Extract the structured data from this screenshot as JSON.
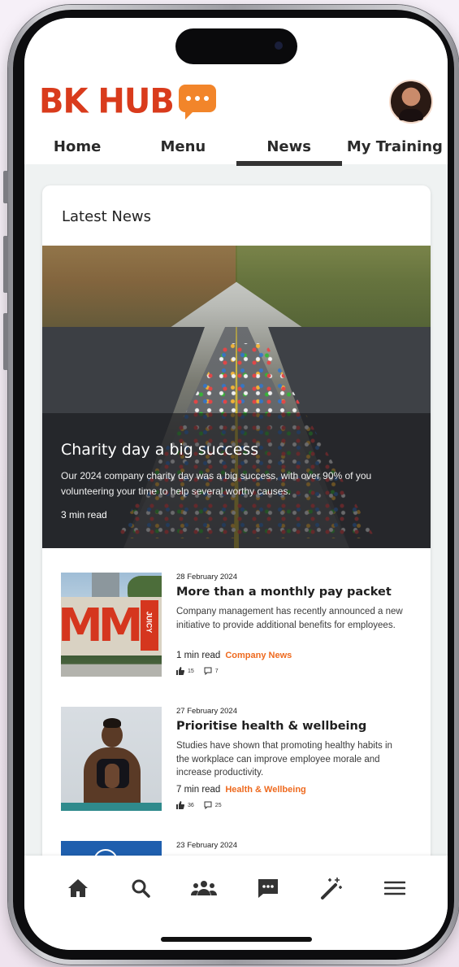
{
  "app": {
    "logo_text": "BK HUB",
    "brand_color": "#d93b1c",
    "accent_color": "#f2852a"
  },
  "tabs": [
    {
      "label": "Home",
      "active": false
    },
    {
      "label": "Menu",
      "active": false
    },
    {
      "label": "News",
      "active": true
    },
    {
      "label": "My Training",
      "active": false
    }
  ],
  "news": {
    "section_title": "Latest News",
    "featured": {
      "title": "Charity day a big success",
      "description": "Our 2024 company charity day was a big success, with over 90% of you volunteering your time to help several worthy causes.",
      "read_time": "3 min read"
    },
    "articles": [
      {
        "date": "28 February 2024",
        "title": "More than a monthly pay packet",
        "summary": "Company management has recently announced a new initiative to provide additional benefits for employees.",
        "read_time": "1 min read",
        "category": "Company News",
        "likes": "15",
        "comments": "7"
      },
      {
        "date": "27 February 2024",
        "title": "Prioritise health & wellbeing",
        "summary": "Studies have shown that promoting healthy habits in the workplace can improve employee morale and increase productivity.",
        "read_time": "7 min read",
        "category": "Health & Wellbeing",
        "likes": "36",
        "comments": "25"
      },
      {
        "date": "23 February 2024",
        "title": "",
        "summary": "",
        "read_time": "",
        "category": "",
        "likes": "",
        "comments": ""
      }
    ],
    "thumb_texts": {
      "billboard": "MM",
      "billboard_side": "JUICY"
    }
  },
  "bottom_nav": {
    "icons": [
      "home-icon",
      "search-icon",
      "people-icon",
      "chat-icon",
      "magic-wand-icon",
      "menu-icon"
    ]
  }
}
